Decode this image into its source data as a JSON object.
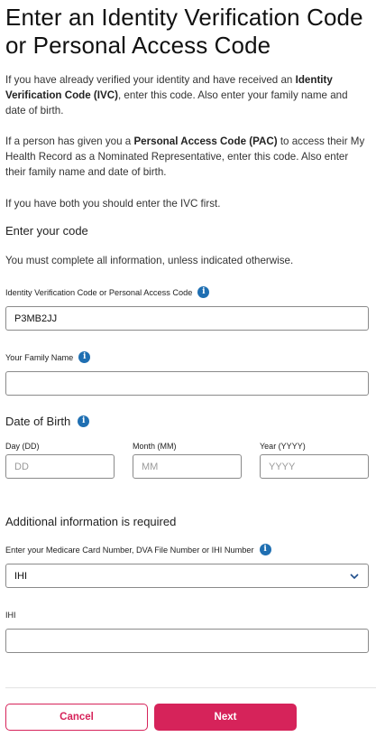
{
  "title": "Enter an Identity Verification Code or Personal Access Code",
  "intro": {
    "p1_pre": "If you have already verified your identity and have received an ",
    "p1_bold": "Identity Verification Code (IVC)",
    "p1_post": ", enter this code. Also enter your family name and date of birth.",
    "p2_pre": "If a person has given you a ",
    "p2_bold": "Personal Access Code (PAC)",
    "p2_post": " to access their My Health Record as a Nominated Representative, enter this code. Also enter their family name and date of birth.",
    "p3": "If you have both you should enter the IVC first."
  },
  "enter_code": {
    "heading": "Enter your code",
    "note": "You must complete all information, unless indicated otherwise.",
    "code_label": "Identity Verification Code or Personal Access Code",
    "code_value": "P3MB2JJ",
    "family_label": "Your Family Name",
    "family_value": ""
  },
  "dob": {
    "heading": "Date of Birth",
    "day_label": "Day (DD)",
    "day_placeholder": "DD",
    "month_label": "Month (MM)",
    "month_placeholder": "MM",
    "year_label": "Year (YYYY)",
    "year_placeholder": "YYYY"
  },
  "additional": {
    "heading": "Additional information is required",
    "select_label": "Enter your Medicare Card Number, DVA File Number or IHI Number",
    "select_value": "IHI",
    "ihi_label": "IHI",
    "ihi_value": ""
  },
  "actions": {
    "cancel_label": "Cancel",
    "next_label": "Next"
  },
  "colors": {
    "accent": "#d6235a",
    "info": "#1f6fb2"
  }
}
